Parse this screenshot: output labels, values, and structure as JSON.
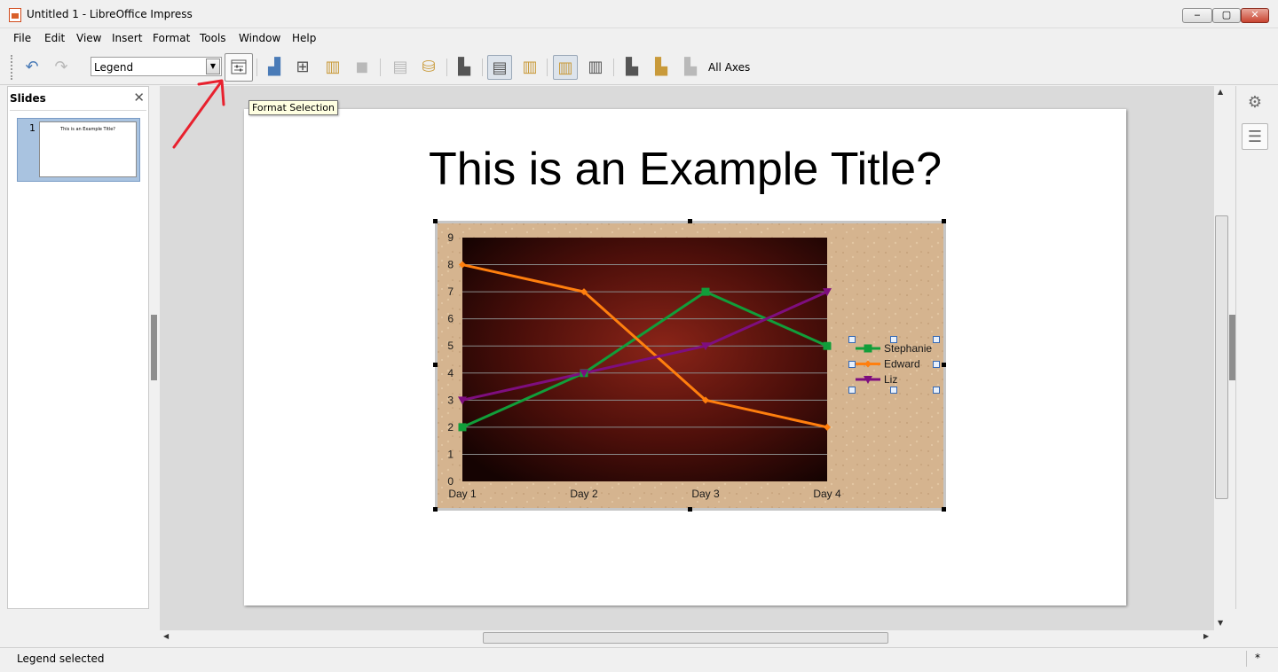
{
  "window": {
    "title": "Untitled 1 - LibreOffice Impress"
  },
  "menubar": {
    "items": [
      "File",
      "Edit",
      "View",
      "Insert",
      "Format",
      "Tools",
      "Window",
      "Help"
    ]
  },
  "toolbar": {
    "selected_element": "Legend",
    "format_selection_tooltip": "Format Selection",
    "all_axes_label": "All Axes"
  },
  "slides_panel": {
    "title": "Slides",
    "slides": [
      {
        "number": "1",
        "title": "This is an Example Title?"
      }
    ]
  },
  "slide": {
    "title": "This is an Example Title?"
  },
  "colors": {
    "accent": "#4a7bb7",
    "annotation": "#e8212e"
  },
  "chart_data": {
    "type": "line",
    "categories": [
      "Day 1",
      "Day 2",
      "Day 3",
      "Day 4"
    ],
    "series": [
      {
        "name": "Stephanie",
        "values": [
          2,
          4,
          7,
          5
        ],
        "color": "#119e3a",
        "marker": "square"
      },
      {
        "name": "Edward",
        "values": [
          8,
          7,
          3,
          2
        ],
        "color": "#ff7f0e",
        "marker": "diamond"
      },
      {
        "name": "Liz",
        "values": [
          3,
          4,
          5,
          7
        ],
        "color": "#7e0e7f",
        "marker": "triangle-down"
      }
    ],
    "yticks": [
      "0",
      "1",
      "2",
      "3",
      "4",
      "5",
      "6",
      "7",
      "8",
      "9"
    ],
    "ylim": [
      0,
      9
    ],
    "grid": true,
    "legend_position": "right",
    "legend_selected": true
  },
  "statusbar": {
    "message": "Legend selected",
    "modified": "*"
  }
}
